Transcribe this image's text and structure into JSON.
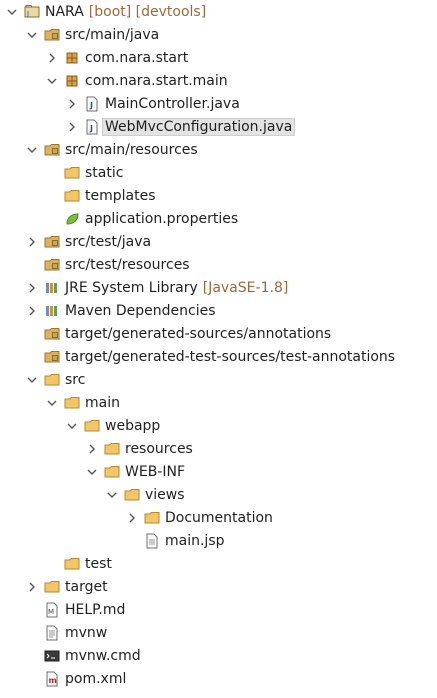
{
  "tree": [
    {
      "label": "NARA",
      "decoration": "[boot] [devtools]",
      "icon": "project-icon",
      "twisty": "expanded",
      "depth": 0
    },
    {
      "label": "src/main/java",
      "icon": "source-folder-icon",
      "twisty": "expanded",
      "depth": 1
    },
    {
      "label": "com.nara.start",
      "icon": "package-icon",
      "twisty": "collapsed",
      "depth": 2
    },
    {
      "label": "com.nara.start.main",
      "icon": "package-icon",
      "twisty": "expanded",
      "depth": 2
    },
    {
      "label": "MainController.java",
      "icon": "java-file-icon",
      "twisty": "collapsed",
      "depth": 3
    },
    {
      "label": "WebMvcConfiguration.java",
      "icon": "java-file-icon",
      "twisty": "collapsed",
      "depth": 3,
      "selected": true
    },
    {
      "label": "src/main/resources",
      "icon": "source-folder-icon",
      "twisty": "expanded",
      "depth": 1
    },
    {
      "label": "static",
      "icon": "folder-icon",
      "twisty": "none",
      "depth": 2
    },
    {
      "label": "templates",
      "icon": "folder-icon",
      "twisty": "none",
      "depth": 2
    },
    {
      "label": "application.properties",
      "icon": "spring-leaf-icon",
      "twisty": "none",
      "depth": 2
    },
    {
      "label": "src/test/java",
      "icon": "source-folder-icon",
      "twisty": "collapsed",
      "depth": 1
    },
    {
      "label": "src/test/resources",
      "icon": "source-folder-icon",
      "twisty": "none",
      "depth": 1
    },
    {
      "label": "JRE System Library",
      "decoration": "[JavaSE-1.8]",
      "icon": "library-icon",
      "twisty": "collapsed",
      "depth": 1
    },
    {
      "label": "Maven Dependencies",
      "icon": "library-icon",
      "twisty": "collapsed",
      "depth": 1
    },
    {
      "label": "target/generated-sources/annotations",
      "icon": "source-folder-icon",
      "twisty": "none",
      "depth": 1
    },
    {
      "label": "target/generated-test-sources/test-annotations",
      "icon": "source-folder-icon",
      "twisty": "none",
      "depth": 1
    },
    {
      "label": "src",
      "icon": "folder-icon",
      "twisty": "expanded",
      "depth": 1
    },
    {
      "label": "main",
      "icon": "folder-icon",
      "twisty": "expanded",
      "depth": 2
    },
    {
      "label": "webapp",
      "icon": "folder-icon",
      "twisty": "expanded",
      "depth": 3
    },
    {
      "label": "resources",
      "icon": "folder-icon",
      "twisty": "collapsed",
      "depth": 4
    },
    {
      "label": "WEB-INF",
      "icon": "folder-icon",
      "twisty": "expanded",
      "depth": 4
    },
    {
      "label": "views",
      "icon": "folder-icon",
      "twisty": "expanded",
      "depth": 5
    },
    {
      "label": "Documentation",
      "icon": "folder-icon",
      "twisty": "collapsed",
      "depth": 6
    },
    {
      "label": "main.jsp",
      "icon": "file-icon",
      "twisty": "none",
      "depth": 6
    },
    {
      "label": "test",
      "icon": "folder-icon",
      "twisty": "none",
      "depth": 2
    },
    {
      "label": "target",
      "icon": "folder-icon",
      "twisty": "collapsed",
      "depth": 1
    },
    {
      "label": "HELP.md",
      "icon": "markdown-file-icon",
      "twisty": "none",
      "depth": 1
    },
    {
      "label": "mvnw",
      "icon": "text-file-icon",
      "twisty": "none",
      "depth": 1
    },
    {
      "label": "mvnw.cmd",
      "icon": "cmd-file-icon",
      "twisty": "none",
      "depth": 1
    },
    {
      "label": "pom.xml",
      "icon": "maven-pom-icon",
      "twisty": "none",
      "depth": 1
    }
  ]
}
